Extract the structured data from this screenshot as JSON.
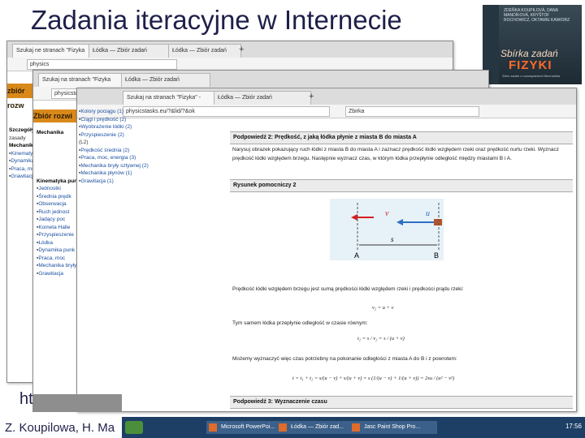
{
  "slide": {
    "title": "Zadania iteracyjne w Internecie",
    "footer": "Z. Koupilowa, H. Ma",
    "link_fragment": "ht"
  },
  "book_cover": {
    "authors": "Zdeňka Koupilová, Dana Mandíková, Kryštof Rochowicz, Oktawie Kawiorz",
    "title_line1": "Sbírka zadań",
    "title_line2": "FIZYKI",
    "subtitle": "Zbiór zadań z rozwiązaniami Mechanika"
  },
  "windows": {
    "back": {
      "tabs": [
        "Szukaj ne stranach \"Fizyka",
        "Łódka — Zbiór zadań",
        "Łódka — Zbiór zadań"
      ],
      "url": "physics",
      "orange_label": "zbiór rozw",
      "sidebar": [
        "Szczegóły",
        "zasady",
        "Mechanika",
        "Kinematyka",
        "Dynamika",
        "Praca, moc",
        "Grawitacja"
      ]
    },
    "middle": {
      "tabs": [
        "Szukaj na stranach \"Fizyka",
        "Łódka — Zbiór zadań"
      ],
      "url": "physicstasks.eu",
      "orange_label": "Zbiór rozwi",
      "sidebar": [
        "Mechanika",
        "Kinematyka pun",
        "Jednostki",
        "Średnia prędk",
        "Obserwacja",
        "Ruch jednost",
        "Jadący poc",
        "Kometa Halle",
        "Przyspieszenie",
        "Łódka",
        "Dynamika punk",
        "Praca, moc",
        "Mechanika bryły",
        "Grawitacja"
      ]
    },
    "front": {
      "tabs": [
        "Szukaj na stranach \"Fizyka\" -",
        "Łódka — Zbiór zadań"
      ],
      "url": "physicstasks.eu/?&lid/?&ok",
      "search": "Zbirka",
      "sidebar": [
        "Kolory pociągu (1)",
        "Ciągi i prędkość (2)",
        "Wyobrażenie łódki (2)",
        "Przyspieszenie (2)",
        "(L2)",
        "Prędkość średnia (2)",
        "Praca, moc, energia (3)",
        "Mechanika bryły sztywnej (2)",
        "Mechanika płynów (1)",
        "Grawitacja (1)"
      ]
    }
  },
  "content": {
    "hint2_title": "Podpowiedź 2: Prędkość, z jaką łódka płynie z miasta B do miasta A",
    "hint2_text": "Narysuj obrazek pokazujący ruch łódki z miasta B do miasta A i zaznacz prędkość łódki względem rzeki oraz prędkość nurtu rzeki. Wyznacz prędkość łódki względem brzegu. Następnie wyznacz czas, w którym łódka przepłynie odległość między miastami B i A.",
    "figure_label": "Rysunek pomocniczy 2",
    "vector_v": "v",
    "vector_u": "u",
    "distance_label": "s",
    "point_a": "A",
    "point_b": "B",
    "speed_text": "Prędkość łódki względem brzegu jest sumą prędkości łódki względem rzeki i prędkości prądu rzeki:",
    "formula1": "v₂ = u + v",
    "time_text": "Tym samem łódka przepłynie odległość w czasie równym:",
    "formula2": "t₂ = s / v₂ = s / (u + v)",
    "total_text": "Możemy wyznaczyć więc czas potrzebny na pokonanie odległości z miasta A do B i z powrotem:",
    "formula3": "t = t₁ + t₂ = s/(u − v) + s/(u + v) = s (1/(u − v) + 1/(u + v)) = 2su / (u² − v²)",
    "hint3_title": "Podpowiedź 3: Wyznaczenie czasu"
  },
  "taskbar": {
    "items": [
      "Microsoft PowerPoi...",
      "Łódka — Zbiór zad...",
      "Jasc Paint Shop Pro..."
    ],
    "clock": "17:56"
  },
  "colors": {
    "title": "#1f1f4a",
    "orange": "#d9891a",
    "vector_red": "#d42020",
    "vector_blue": "#2f6fc4"
  }
}
